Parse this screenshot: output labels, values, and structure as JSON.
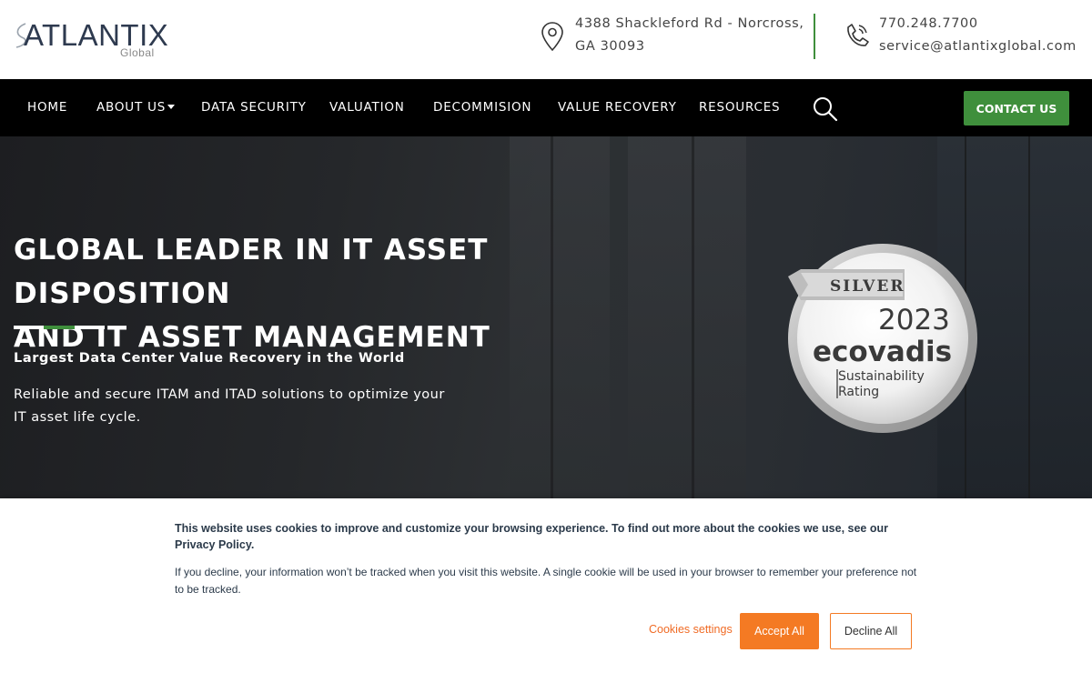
{
  "header": {
    "logo_text": "ATLANTIX",
    "logo_sub": "Global",
    "address_line1": "4388 Shackleford Rd - Norcross,",
    "address_line2": "GA 30093",
    "phone": "770.248.7700",
    "email": "service@atlantixglobal.com",
    "accent_color": "#3f8f3c",
    "address_icon": "map-pin-icon",
    "phone_icon": "phone-icon"
  },
  "nav": {
    "items": [
      "HOME",
      "ABOUT US",
      "DATA SECURITY",
      "VALUATION",
      "DECOMMISION",
      "VALUE RECOVERY",
      "RESOURCES"
    ],
    "search_icon": "search-icon",
    "contact_label": "CONTACT US"
  },
  "hero": {
    "title_line1": "GLOBAL LEADER IN IT ASSET DISPOSITION",
    "title_line2": "AND IT ASSET MANAGEMENT",
    "subtitle": "Largest Data Center Value Recovery in the World",
    "description": "Reliable and secure ITAM and ITAD solutions to optimize your IT asset life cycle."
  },
  "badge": {
    "ribbon": "SILVER",
    "year": "2023",
    "brand": "ecovadis",
    "line1": "Sustainability",
    "line2": "Rating"
  },
  "cookie": {
    "main_text": "This website uses cookies to improve and customize your browsing experience. To find out more about the cookies we use, see our Privacy Policy.",
    "note_text": "If you decline, your information won’t be tracked when you visit this website. A single cookie will be used in your browser to remember your preference not to be tracked.",
    "settings_label": "Cookies settings",
    "accept_label": "Accept All",
    "decline_label": "Decline All",
    "accent_color": "#f47a23"
  }
}
